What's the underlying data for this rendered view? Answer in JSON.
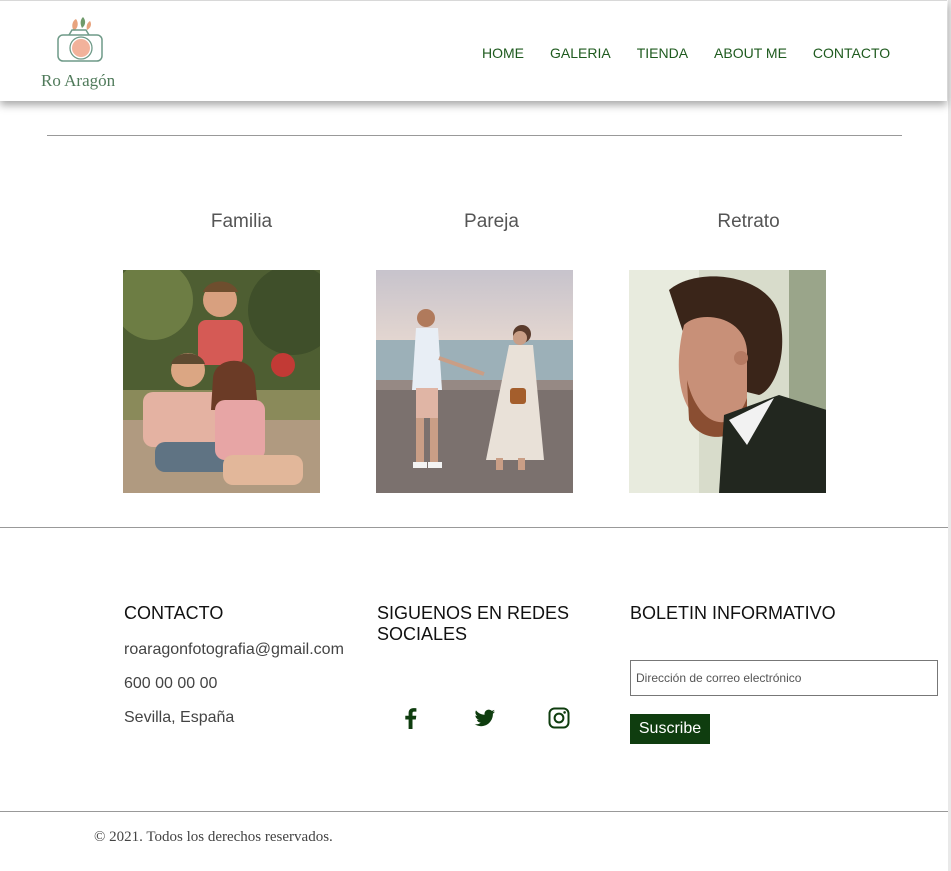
{
  "brand": {
    "name": "Ro Aragón"
  },
  "nav": {
    "items": [
      "HOME",
      "GALERIA",
      "TIENDA",
      "ABOUT ME",
      "CONTACTO"
    ]
  },
  "gallery": {
    "categories": [
      {
        "title": "Familia",
        "image": "family-photo"
      },
      {
        "title": "Pareja",
        "image": "couple-photo"
      },
      {
        "title": "Retrato",
        "image": "portrait-photo"
      }
    ]
  },
  "footer": {
    "contact": {
      "heading": "CONTACTO",
      "email": "roaragonfotografia@gmail.com",
      "phone": "600 00 00 00",
      "location": "Sevilla, España"
    },
    "social": {
      "heading": "SIGUENOS EN REDES SOCIALES",
      "icons": [
        "facebook-icon",
        "twitter-icon",
        "instagram-icon"
      ]
    },
    "newsletter": {
      "heading": "BOLETIN INFORMATIVO",
      "placeholder": "Dirección de correo electrónico",
      "value": "",
      "button": "Suscribe"
    },
    "copyright": "© 2021. Todos los derechos reservados."
  },
  "colors": {
    "nav": "#1e5a1e",
    "button": "#0f3d0f",
    "logo": "#4f7a5a",
    "accent": "#f0a58a"
  }
}
